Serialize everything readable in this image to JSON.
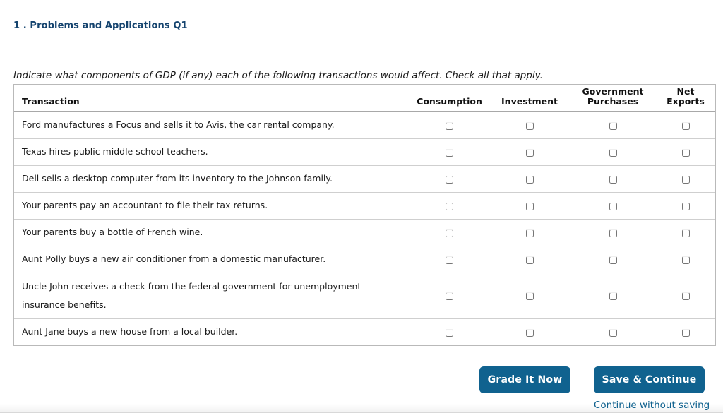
{
  "question": {
    "title": "1 . Problems and Applications Q1",
    "instructions": "Indicate what components of GDP (if any) each of the following transactions would affect. Check all that apply."
  },
  "table": {
    "headers": {
      "transaction": "Transaction",
      "consumption": "Consumption",
      "investment": "Investment",
      "government_purchases_line1": "Government",
      "government_purchases_line2": "Purchases",
      "net_exports_line1": "Net",
      "net_exports_line2": "Exports"
    },
    "rows": [
      {
        "transaction": "Ford manufactures a Focus and sells it to Avis, the car rental company.",
        "transaction_line2": "",
        "consumption_checked": false,
        "investment_checked": false,
        "government_checked": false,
        "net_exports_checked": false
      },
      {
        "transaction": "Texas hires public middle school teachers.",
        "transaction_line2": "",
        "consumption_checked": false,
        "investment_checked": false,
        "government_checked": false,
        "net_exports_checked": false
      },
      {
        "transaction": "Dell sells a desktop computer from its inventory to the Johnson family.",
        "transaction_line2": "",
        "consumption_checked": false,
        "investment_checked": false,
        "government_checked": false,
        "net_exports_checked": false
      },
      {
        "transaction": "Your parents pay an accountant to file their tax returns.",
        "transaction_line2": "",
        "consumption_checked": false,
        "investment_checked": false,
        "government_checked": false,
        "net_exports_checked": false
      },
      {
        "transaction": "Your parents buy a bottle of French wine.",
        "transaction_line2": "",
        "consumption_checked": false,
        "investment_checked": false,
        "government_checked": false,
        "net_exports_checked": false
      },
      {
        "transaction": "Aunt Polly buys a new air conditioner from a domestic manufacturer.",
        "transaction_line2": "",
        "consumption_checked": false,
        "investment_checked": false,
        "government_checked": false,
        "net_exports_checked": false
      },
      {
        "transaction": "Uncle John receives a check from the federal government for unemployment",
        "transaction_line2": "insurance benefits.",
        "consumption_checked": false,
        "investment_checked": false,
        "government_checked": false,
        "net_exports_checked": false
      },
      {
        "transaction": "Aunt Jane buys a new house from a local builder.",
        "transaction_line2": "",
        "consumption_checked": false,
        "investment_checked": false,
        "government_checked": false,
        "net_exports_checked": false
      }
    ]
  },
  "actions": {
    "grade_it_now": "Grade It Now",
    "save_and_continue": "Save & Continue",
    "continue_without_saving": "Continue without saving"
  },
  "colors": {
    "title_blue": "#14436e",
    "button_blue": "#10628f",
    "link_blue": "#10628f",
    "table_border": "#b9b9b9",
    "row_divider": "#cfcfcf"
  }
}
